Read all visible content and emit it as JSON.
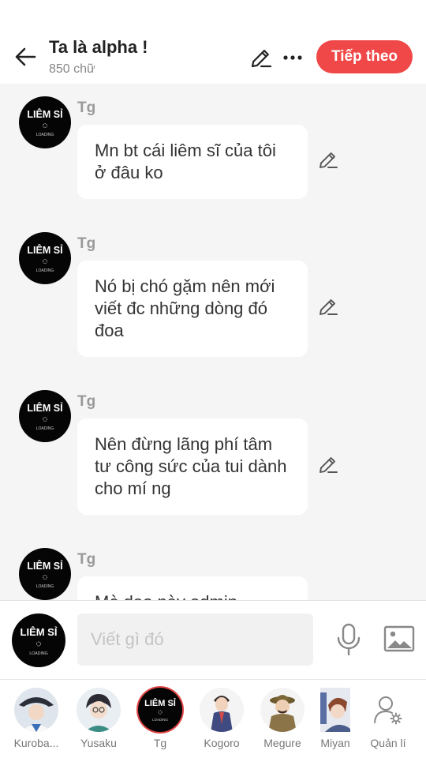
{
  "header": {
    "title": "Ta là alpha !",
    "word_count": "850 chữ",
    "next_label": "Tiếp theo",
    "accent_color": "#f04848"
  },
  "avatar_logo": {
    "line1": "LIÊM SỈ",
    "line2": "LOADING"
  },
  "messages": [
    {
      "sender": "Tg",
      "text": "Mn bt cái liêm sĩ của tôi ở đâu ko"
    },
    {
      "sender": "Tg",
      "text": "Nó bị chó gặm nên mới viết đc những dòng đó đoa"
    },
    {
      "sender": "Tg",
      "text": "Nên đừng lãng phí tâm tư công sức của tui dành cho mí ng"
    },
    {
      "sender": "Tg",
      "text": "Mè dạo này admin"
    }
  ],
  "composer": {
    "placeholder": "Viết gì đó",
    "mic_icon": "microphone-icon",
    "image_icon": "image-icon"
  },
  "characters": [
    {
      "name": "Kuroba...",
      "selected": false
    },
    {
      "name": "Yusaku",
      "selected": false
    },
    {
      "name": "Tg",
      "selected": true
    },
    {
      "name": "Kogoro",
      "selected": false
    },
    {
      "name": "Megure",
      "selected": false
    },
    {
      "name": "Miyan",
      "selected": false
    }
  ],
  "manage": {
    "label": "Quản lí",
    "icon": "user-settings-icon"
  }
}
